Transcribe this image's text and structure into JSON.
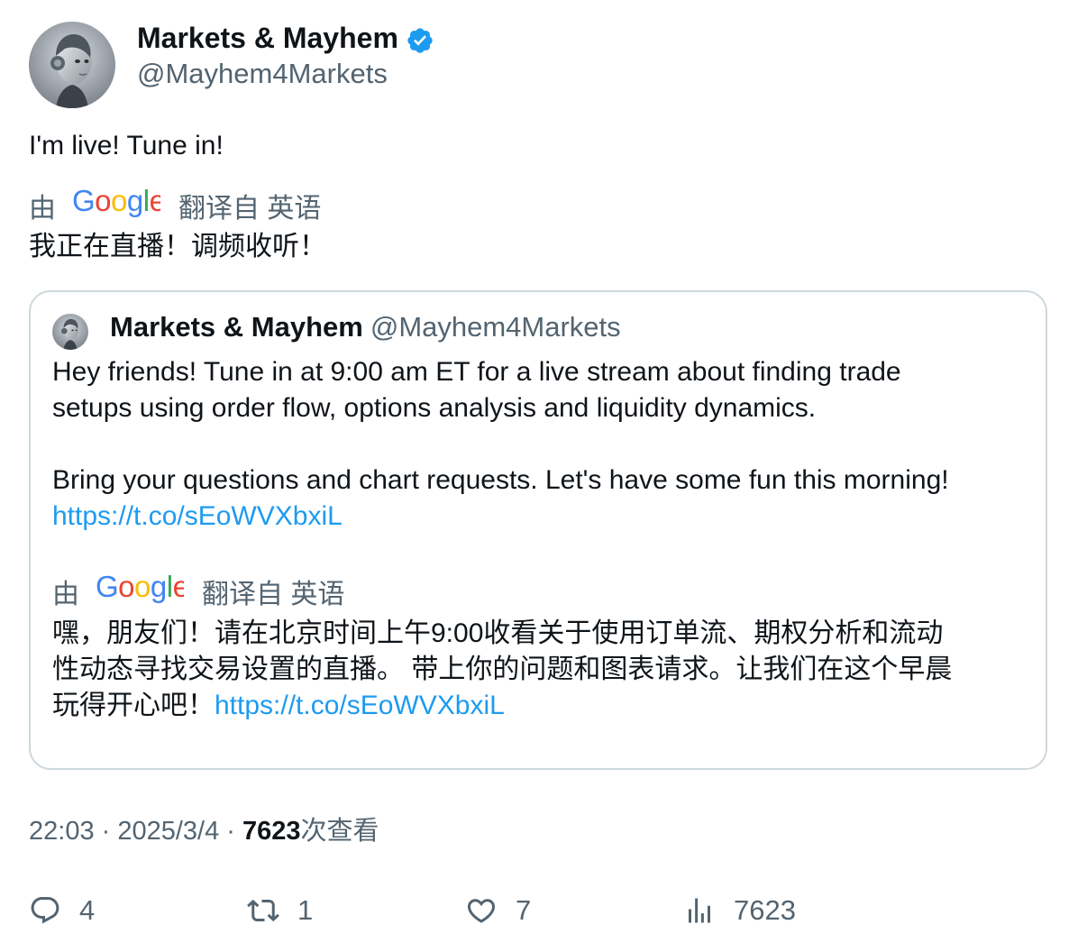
{
  "author": {
    "display_name": "Markets & Mayhem",
    "handle": "@Mayhem4Markets",
    "verified": true
  },
  "tweet": {
    "text": "I'm live! Tune in!",
    "translation": {
      "prefix": "由",
      "provider": "Google",
      "suffix": "翻译自 英语",
      "text": "我正在直播！调频收听！"
    }
  },
  "quoted_tweet": {
    "display_name": "Markets & Mayhem",
    "handle": "@Mayhem4Markets",
    "lines": [
      "Hey friends! Tune in at 9:00 am ET for a live stream about finding trade",
      "setups using order flow, options analysis and liquidity dynamics.",
      "Bring your questions and chart requests. Let's have some fun this morning!"
    ],
    "link": "https://t.co/sEoWVXbxiL",
    "translation": {
      "prefix": "由",
      "provider": "Google",
      "suffix": "翻译自 英语",
      "lines": [
        "嘿，朋友们！请在北京时间上午9:00收看关于使用订单流、期权分析和流动",
        "性动态寻找交易设置的直播。 带上你的问题和图表请求。让我们在这个早晨",
        "玩得开心吧！"
      ],
      "link": "https://t.co/sEoWVXbxiL"
    }
  },
  "meta": {
    "time": "22:03",
    "separator": " · ",
    "date": "2025/3/4",
    "views_count": "7623",
    "views_label": "次查看"
  },
  "actions": {
    "replies": "4",
    "reposts": "1",
    "likes": "7",
    "views": "7623"
  },
  "colors": {
    "accent": "#1d9bf0",
    "secondary_text": "#536471",
    "border": "#cfd9de"
  },
  "icons": [
    "verified-badge-icon",
    "google-logo",
    "reply-icon",
    "repost-icon",
    "like-icon",
    "views-icon"
  ]
}
